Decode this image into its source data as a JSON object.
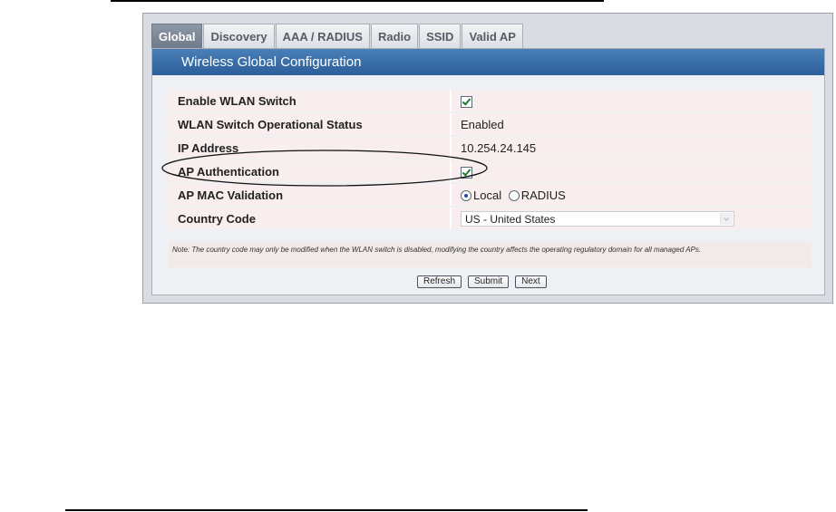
{
  "tabs": [
    {
      "label": "Global",
      "active": true
    },
    {
      "label": "Discovery",
      "active": false
    },
    {
      "label": "AAA / RADIUS",
      "active": false
    },
    {
      "label": "Radio",
      "active": false
    },
    {
      "label": "SSID",
      "active": false
    },
    {
      "label": "Valid AP",
      "active": false
    }
  ],
  "panel": {
    "title": "Wireless Global Configuration"
  },
  "form": {
    "enable_wlan_switch": {
      "label": "Enable WLAN Switch",
      "checked": true
    },
    "operational_status": {
      "label": "WLAN Switch Operational Status",
      "value": "Enabled"
    },
    "ip_address": {
      "label": "IP Address",
      "value": "10.254.24.145"
    },
    "ap_authentication": {
      "label": "AP Authentication",
      "checked": true
    },
    "ap_mac_validation": {
      "label": "AP MAC Validation",
      "options": [
        "Local",
        "RADIUS"
      ],
      "selected": "Local"
    },
    "country_code": {
      "label": "Country Code",
      "value": "US - United States"
    }
  },
  "note": "Note: The country code may only be modified when the WLAN switch is disabled, modifying the country affects the operating regulatory domain for all managed APs.",
  "buttons": {
    "refresh": "Refresh",
    "submit": "Submit",
    "next": "Next"
  },
  "colors": {
    "header_blue": "#2d5f99",
    "active_tab": "#7a8494",
    "row_bg": "#f8eeee",
    "check_green": "#1f7a2e"
  }
}
